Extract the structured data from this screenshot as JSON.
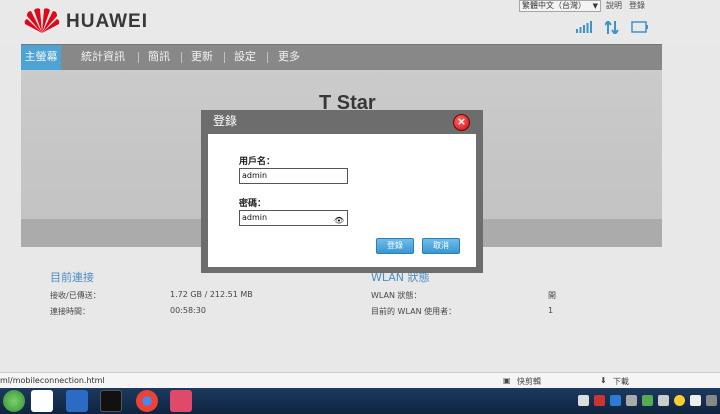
{
  "header": {
    "brand": "HUAWEI",
    "language": "繁體中文（台灣）",
    "help_label": "說明",
    "login_label": "登錄"
  },
  "nav": {
    "items": [
      {
        "label": "主螢幕",
        "active": true
      },
      {
        "label": "統計資訊",
        "active": false
      },
      {
        "label": "簡訊",
        "active": false
      },
      {
        "label": "更新",
        "active": false
      },
      {
        "label": "設定",
        "active": false
      },
      {
        "label": "更多",
        "active": false
      }
    ]
  },
  "banner": {
    "title": "T Star"
  },
  "connection": {
    "title": "目前連接",
    "rows": [
      {
        "label": "接收/已傳送：",
        "value": "1.72 GB / 212.51 MB"
      },
      {
        "label": "連接時間：",
        "value": "00:58:30"
      }
    ]
  },
  "wlan": {
    "title": "WLAN 狀態",
    "rows": [
      {
        "label": "WLAN 狀態：",
        "value": "開"
      },
      {
        "label": "目前的 WLAN 使用者：",
        "value": "1"
      }
    ]
  },
  "login_dialog": {
    "title": "登錄",
    "username_label": "用戶名：",
    "username_value": "admin",
    "password_label": "密碼：",
    "password_value": "admin",
    "login_button": "登錄",
    "cancel_button": "取消"
  },
  "statusbar": {
    "url": "ml/mobileconnection.html",
    "shortcut_label": "快剪輯",
    "download_label": "下載"
  },
  "colors": {
    "nav_active": "#4aa8dc",
    "section_title": "#4a90c8",
    "brand_red": "#e60012",
    "dialog_header": "#6d6d6d"
  },
  "icons": [
    "huawei-logo",
    "signal-icon",
    "data-transfer-icon",
    "battery-icon",
    "close-icon",
    "eye-icon"
  ]
}
